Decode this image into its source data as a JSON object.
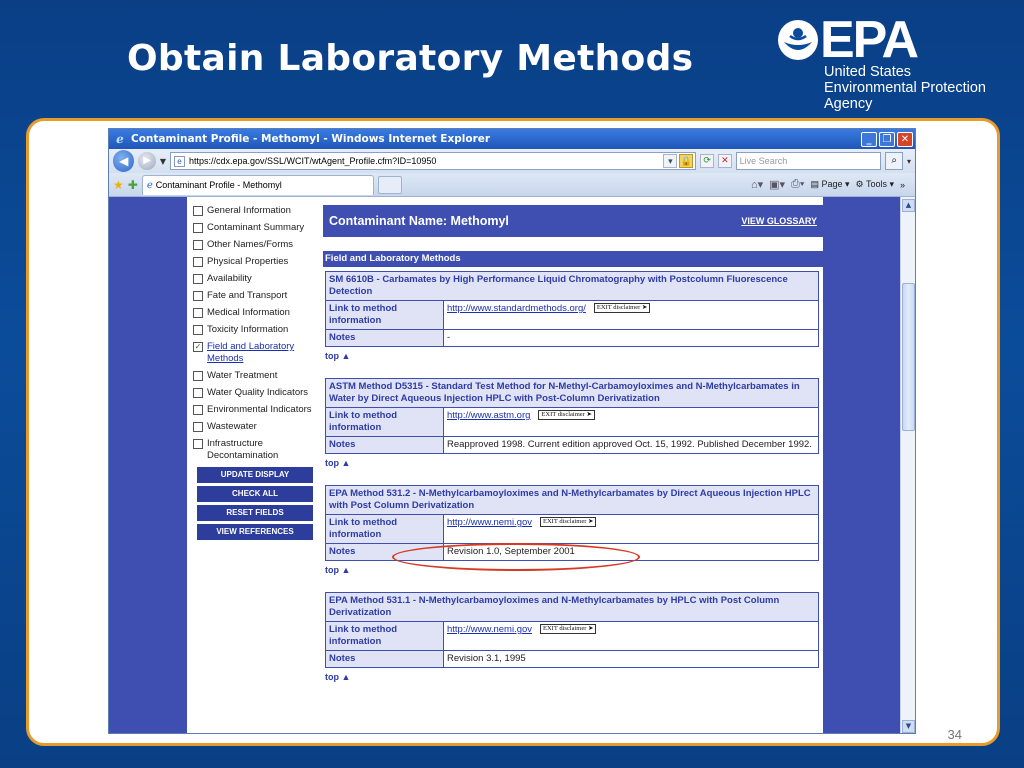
{
  "slide": {
    "title": "Obtain Laboratory Methods",
    "page_number": "34",
    "logo": {
      "name": "EPA",
      "line1": "United States",
      "line2": "Environmental Protection",
      "line3": "Agency"
    }
  },
  "browser": {
    "window_title": "Contaminant Profile - Methomyl - Windows Internet Explorer",
    "url": "https://cdx.epa.gov/SSL/WCIT/wtAgent_Profile.cfm?ID=10950",
    "search_placeholder": "Live Search",
    "tab_title": "Contaminant Profile - Methomyl",
    "cmd_page": "Page",
    "cmd_tools": "Tools"
  },
  "sidebar": {
    "items": [
      {
        "label": "General Information",
        "checked": false
      },
      {
        "label": "Contaminant Summary",
        "checked": false
      },
      {
        "label": "Other Names/Forms",
        "checked": false
      },
      {
        "label": "Physical Properties",
        "checked": false
      },
      {
        "label": "Availability",
        "checked": false
      },
      {
        "label": "Fate and Transport",
        "checked": false
      },
      {
        "label": "Medical Information",
        "checked": false
      },
      {
        "label": "Toxicity Information",
        "checked": false
      },
      {
        "label": "Field and Laboratory Methods",
        "checked": true
      },
      {
        "label": "Water Treatment",
        "checked": false
      },
      {
        "label": "Water Quality Indicators",
        "checked": false
      },
      {
        "label": "Environmental Indicators",
        "checked": false
      },
      {
        "label": "Wastewater",
        "checked": false
      },
      {
        "label": "Infrastructure Decontamination",
        "checked": false
      }
    ],
    "buttons": [
      "UPDATE DISPLAY",
      "CHECK ALL",
      "RESET FIELDS",
      "VIEW REFERENCES"
    ]
  },
  "main": {
    "contaminant_name": "Contaminant Name: Methomyl",
    "view_glossary": "VIEW GLOSSARY",
    "section_title": "Field and Laboratory Methods",
    "link_label": "Link to method information",
    "notes_label": "Notes",
    "exit_label": "EXIT disclaimer",
    "top_label": "top",
    "methods": [
      {
        "title": "SM 6610B - Carbamates by High Performance Liquid Chromatography with Postcolumn Fluorescence Detection",
        "link": "http://www.standardmethods.org/",
        "notes": "-"
      },
      {
        "title": "ASTM Method D5315 - Standard Test Method for N-Methyl-Carbamoyloximes and N-Methylcarbamates in Water by Direct Aqueous Injection HPLC with Post-Column Derivatization",
        "link": "http://www.astm.org",
        "notes": "Reapproved 1998. Current edition approved Oct. 15, 1992. Published December 1992."
      },
      {
        "title": "EPA Method 531.2 - N-Methylcarbamoyloximes and N-Methylcarbamates by Direct Aqueous Injection HPLC with Post Column Derivatization",
        "link": "http://www.nemi.gov",
        "notes": "Revision 1.0, September 2001"
      },
      {
        "title": "EPA Method 531.1 - N-Methylcarbamoyloximes and N-Methylcarbamates by HPLC with Post Column Derivatization",
        "link": "http://www.nemi.gov",
        "notes": "Revision 3.1, 1995"
      }
    ]
  }
}
